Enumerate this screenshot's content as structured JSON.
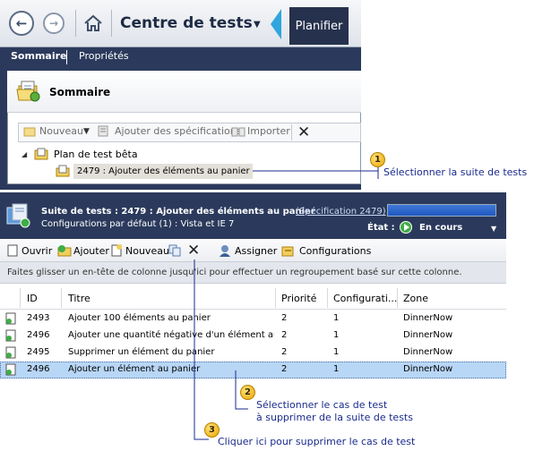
{
  "top": {
    "nav": {
      "back_icon": "back-arrow-icon",
      "forward_icon": "forward-arrow-icon",
      "home_icon": "home-icon"
    },
    "app_title": "Centre de tests",
    "active_tab": "Planifier",
    "subtabs": [
      "Sommaire",
      "Propriétés"
    ],
    "summary_title": "Sommaire",
    "toolbar": {
      "new": "Nouveau",
      "add_req": "Ajouter des spécifications",
      "import": "Importer"
    },
    "tree": {
      "plan": "Plan de test bêta",
      "suite": "2479 : Ajouter des éléments au panier"
    }
  },
  "suite": {
    "title": "Suite de tests :  2479 : Ajouter des éléments au panier",
    "link": "(Spécification 2479)",
    "configs": "Configurations par défaut (1) : Vista et IE 7",
    "state_label": "État :",
    "state_value": "En cours",
    "progress": 1.0
  },
  "toolbar2": {
    "open": "Ouvrir",
    "add": "Ajouter",
    "new": "Nouveau",
    "assign": "Assigner",
    "configurations": "Configurations"
  },
  "group_hint": "Faites glisser un en-tête de colonne jusqu'ici pour effectuer un regroupement basé sur cette colonne.",
  "grid": {
    "columns": [
      "ID",
      "Titre",
      "Priorité",
      "Configurati...",
      "Zone"
    ],
    "rows": [
      {
        "id": "2493",
        "title": "Ajouter 100 éléments au panier",
        "priority": "2",
        "config": "1",
        "zone": "DinnerNow"
      },
      {
        "id": "2496",
        "title": "Ajouter une quantité négative d'un élément au...",
        "priority": "2",
        "config": "1",
        "zone": "DinnerNow"
      },
      {
        "id": "2495",
        "title": "Supprimer un élément du panier",
        "priority": "2",
        "config": "1",
        "zone": "DinnerNow"
      },
      {
        "id": "2496",
        "title": "Ajouter un élément au panier",
        "priority": "2",
        "config": "1",
        "zone": "DinnerNow"
      }
    ]
  },
  "callouts": [
    {
      "num": "1",
      "text": "Sélectionner la suite de tests"
    },
    {
      "num": "2",
      "text": "Sélectionner le cas de test",
      "text2": "à supprimer de la suite de tests"
    },
    {
      "num": "3",
      "text": "Cliquer ici pour supprimer le cas de test"
    }
  ],
  "colors": {
    "navy": "#2b3a5c",
    "callout_line": "#1a2a8c",
    "selection": "#b8d6f5"
  }
}
